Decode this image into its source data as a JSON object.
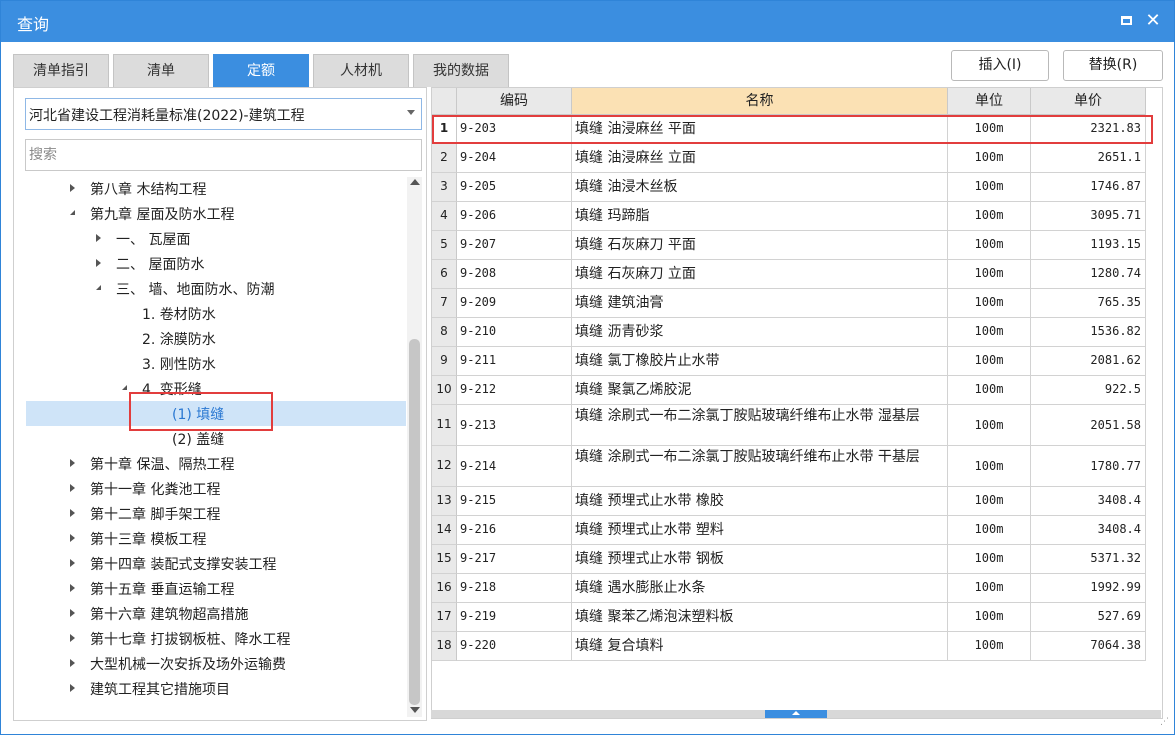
{
  "window": {
    "title": "查询"
  },
  "tabs": [
    {
      "label": "清单指引",
      "active": false
    },
    {
      "label": "清单",
      "active": false
    },
    {
      "label": "定额",
      "active": true
    },
    {
      "label": "人材机",
      "active": false
    },
    {
      "label": "我的数据",
      "active": false
    }
  ],
  "toolbar": {
    "insert_label": "插入(I)",
    "replace_label": "替换(R)"
  },
  "library": {
    "selected": "河北省建设工程消耗量标准(2022)-建筑工程"
  },
  "search": {
    "placeholder": "搜索",
    "value": ""
  },
  "tree": [
    {
      "label": "第八章 木结构工程",
      "level": 0,
      "toggle": "closed",
      "selected": false
    },
    {
      "label": "第九章 屋面及防水工程",
      "level": 0,
      "toggle": "open",
      "selected": false
    },
    {
      "label": "一、 瓦屋面",
      "level": 1,
      "toggle": "closed",
      "selected": false
    },
    {
      "label": "二、 屋面防水",
      "level": 1,
      "toggle": "closed",
      "selected": false
    },
    {
      "label": "三、 墙、地面防水、防潮",
      "level": 1,
      "toggle": "open",
      "selected": false
    },
    {
      "label": "1. 卷材防水",
      "level": 2,
      "toggle": "none",
      "selected": false
    },
    {
      "label": "2. 涂膜防水",
      "level": 2,
      "toggle": "none",
      "selected": false
    },
    {
      "label": "3. 刚性防水",
      "level": 2,
      "toggle": "none",
      "selected": false
    },
    {
      "label": "4. 变形缝",
      "level": 2,
      "toggle": "open",
      "selected": false
    },
    {
      "label": "(1) 填缝",
      "level": 3,
      "toggle": "none",
      "selected": true
    },
    {
      "label": "(2) 盖缝",
      "level": 3,
      "toggle": "none",
      "selected": false
    },
    {
      "label": "第十章 保温、隔热工程",
      "level": 0,
      "toggle": "closed",
      "selected": false
    },
    {
      "label": "第十一章 化粪池工程",
      "level": 0,
      "toggle": "closed",
      "selected": false
    },
    {
      "label": "第十二章 脚手架工程",
      "level": 0,
      "toggle": "closed",
      "selected": false
    },
    {
      "label": "第十三章 模板工程",
      "level": 0,
      "toggle": "closed",
      "selected": false
    },
    {
      "label": "第十四章 装配式支撑安装工程",
      "level": 0,
      "toggle": "closed",
      "selected": false
    },
    {
      "label": "第十五章 垂直运输工程",
      "level": 0,
      "toggle": "closed",
      "selected": false
    },
    {
      "label": "第十六章 建筑物超高措施",
      "level": 0,
      "toggle": "closed",
      "selected": false
    },
    {
      "label": "第十七章 打拔钢板桩、降水工程",
      "level": 0,
      "toggle": "closed",
      "selected": false
    },
    {
      "label": "大型机械一次安拆及场外运输费",
      "level": 0,
      "toggle": "closed",
      "selected": false
    },
    {
      "label": "建筑工程其它措施项目",
      "level": 0,
      "toggle": "closed",
      "selected": false
    }
  ],
  "grid": {
    "headers": {
      "code": "编码",
      "name": "名称",
      "unit": "单位",
      "price": "单价"
    },
    "rows": [
      {
        "idx": "1",
        "code": "9-203",
        "name": "填缝 油浸麻丝 平面",
        "unit": "100m",
        "price": "2321.83",
        "tall": false
      },
      {
        "idx": "2",
        "code": "9-204",
        "name": "填缝 油浸麻丝 立面",
        "unit": "100m",
        "price": "2651.1",
        "tall": false
      },
      {
        "idx": "3",
        "code": "9-205",
        "name": "填缝 油浸木丝板",
        "unit": "100m",
        "price": "1746.87",
        "tall": false
      },
      {
        "idx": "4",
        "code": "9-206",
        "name": "填缝 玛蹄脂",
        "unit": "100m",
        "price": "3095.71",
        "tall": false
      },
      {
        "idx": "5",
        "code": "9-207",
        "name": "填缝 石灰麻刀 平面",
        "unit": "100m",
        "price": "1193.15",
        "tall": false
      },
      {
        "idx": "6",
        "code": "9-208",
        "name": "填缝 石灰麻刀 立面",
        "unit": "100m",
        "price": "1280.74",
        "tall": false
      },
      {
        "idx": "7",
        "code": "9-209",
        "name": "填缝 建筑油膏",
        "unit": "100m",
        "price": "765.35",
        "tall": false
      },
      {
        "idx": "8",
        "code": "9-210",
        "name": "填缝 沥青砂浆",
        "unit": "100m",
        "price": "1536.82",
        "tall": false
      },
      {
        "idx": "9",
        "code": "9-211",
        "name": "填缝 氯丁橡胶片止水带",
        "unit": "100m",
        "price": "2081.62",
        "tall": false
      },
      {
        "idx": "10",
        "code": "9-212",
        "name": "填缝 聚氯乙烯胶泥",
        "unit": "100m",
        "price": "922.5",
        "tall": false
      },
      {
        "idx": "11",
        "code": "9-213",
        "name": "填缝 涂刷式一布二涂氯丁胺贴玻璃纤维布止水带 湿基层",
        "unit": "100m",
        "price": "2051.58",
        "tall": true
      },
      {
        "idx": "12",
        "code": "9-214",
        "name": "填缝 涂刷式一布二涂氯丁胺贴玻璃纤维布止水带 干基层",
        "unit": "100m",
        "price": "1780.77",
        "tall": true
      },
      {
        "idx": "13",
        "code": "9-215",
        "name": "填缝 预埋式止水带 橡胶",
        "unit": "100m",
        "price": "3408.4",
        "tall": false
      },
      {
        "idx": "14",
        "code": "9-216",
        "name": "填缝 预埋式止水带 塑料",
        "unit": "100m",
        "price": "3408.4",
        "tall": false
      },
      {
        "idx": "15",
        "code": "9-217",
        "name": "填缝 预埋式止水带 钢板",
        "unit": "100m",
        "price": "5371.32",
        "tall": false
      },
      {
        "idx": "16",
        "code": "9-218",
        "name": "填缝 遇水膨胀止水条",
        "unit": "100m",
        "price": "1992.99",
        "tall": false
      },
      {
        "idx": "17",
        "code": "9-219",
        "name": "填缝 聚苯乙烯泡沫塑料板",
        "unit": "100m",
        "price": "527.69",
        "tall": false
      },
      {
        "idx": "18",
        "code": "9-220",
        "name": "填缝 复合填料",
        "unit": "100m",
        "price": "7064.38",
        "tall": false
      }
    ]
  }
}
